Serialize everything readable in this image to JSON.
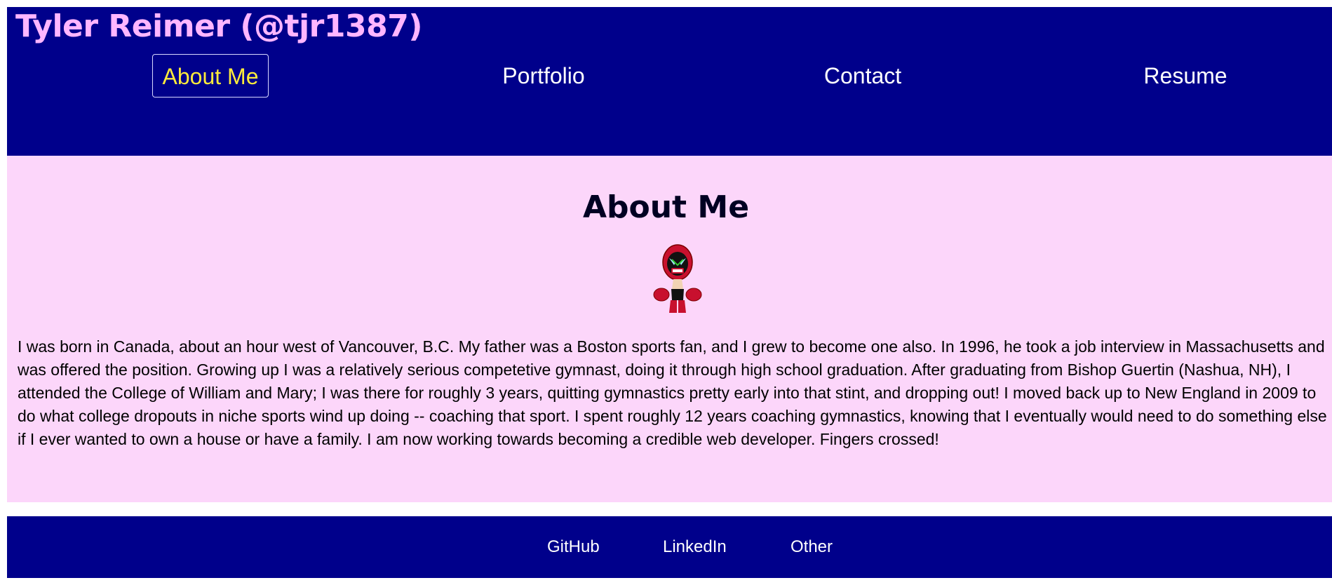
{
  "header": {
    "site_title": "Tyler Reimer (@tjr1387)",
    "nav": [
      {
        "label": "About Me",
        "active": true
      },
      {
        "label": "Portfolio",
        "active": false
      },
      {
        "label": "Contact",
        "active": false
      },
      {
        "label": "Resume",
        "active": false
      }
    ]
  },
  "main": {
    "heading": "About Me",
    "avatar_icon": "strong-bad-avatar-icon",
    "bio": "I was born in Canada, about an hour west of Vancouver, B.C. My father was a Boston sports fan, and I grew to become one also. In 1996, he took a job interview in Massachusetts and was offered the position. Growing up I was a relatively serious competetive gymnast, doing it through high school graduation. After graduating from Bishop Guertin (Nashua, NH), I attended the College of William and Mary; I was there for roughly 3 years, quitting gymnastics pretty early into that stint, and dropping out! I moved back up to New England in 2009 to do what college dropouts in niche sports wind up doing -- coaching that sport. I spent roughly 12 years coaching gymnastics, knowing that I eventually would need to do something else if I ever wanted to own a house or have a family. I am now working towards becoming a credible web developer. Fingers crossed!"
  },
  "footer": {
    "links": [
      {
        "label": "GitHub"
      },
      {
        "label": "LinkedIn"
      },
      {
        "label": "Other"
      }
    ]
  },
  "colors": {
    "header_bg": "#00008b",
    "title_text": "#ffb6ff",
    "nav_active_text": "#ffeb3b",
    "nav_text": "#ffffff",
    "main_bg": "#fcd6fa"
  }
}
